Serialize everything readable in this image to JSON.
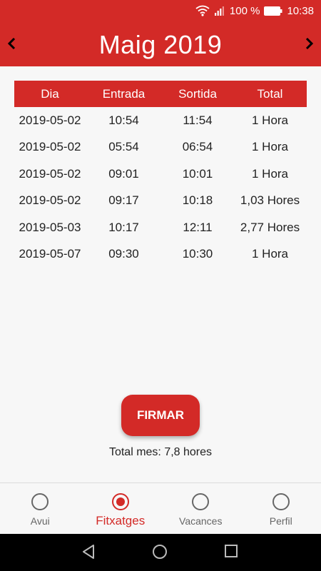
{
  "status_bar": {
    "battery_percent": "100 %",
    "time": "10:38"
  },
  "header": {
    "title": "Maig 2019",
    "prev_icon": "chevron-left-icon",
    "next_icon": "chevron-right-icon"
  },
  "table": {
    "columns": [
      "Dia",
      "Entrada",
      "Sortida",
      "Total"
    ],
    "rows": [
      [
        "2019-05-02",
        "10:54",
        "11:54",
        "1 Hora"
      ],
      [
        "2019-05-02",
        "05:54",
        "06:54",
        "1 Hora"
      ],
      [
        "2019-05-02",
        "09:01",
        "10:01",
        "1 Hora"
      ],
      [
        "2019-05-02",
        "09:17",
        "10:18",
        "1,03 Hores"
      ],
      [
        "2019-05-03",
        "10:17",
        "12:11",
        "2,77 Hores"
      ],
      [
        "2019-05-07",
        "09:30",
        "10:30",
        "1 Hora"
      ]
    ]
  },
  "actions": {
    "sign_label": "FIRMAR"
  },
  "summary": {
    "total_label": "Total mes: 7,8 hores"
  },
  "bottom_nav": {
    "items": [
      {
        "label": "Avui",
        "active": false
      },
      {
        "label": "Fitxatges",
        "active": true
      },
      {
        "label": "Vacances",
        "active": false
      },
      {
        "label": "Perfil",
        "active": false
      }
    ]
  },
  "colors": {
    "primary": "#d32a27",
    "text": "#222222",
    "inactive": "#666666"
  }
}
